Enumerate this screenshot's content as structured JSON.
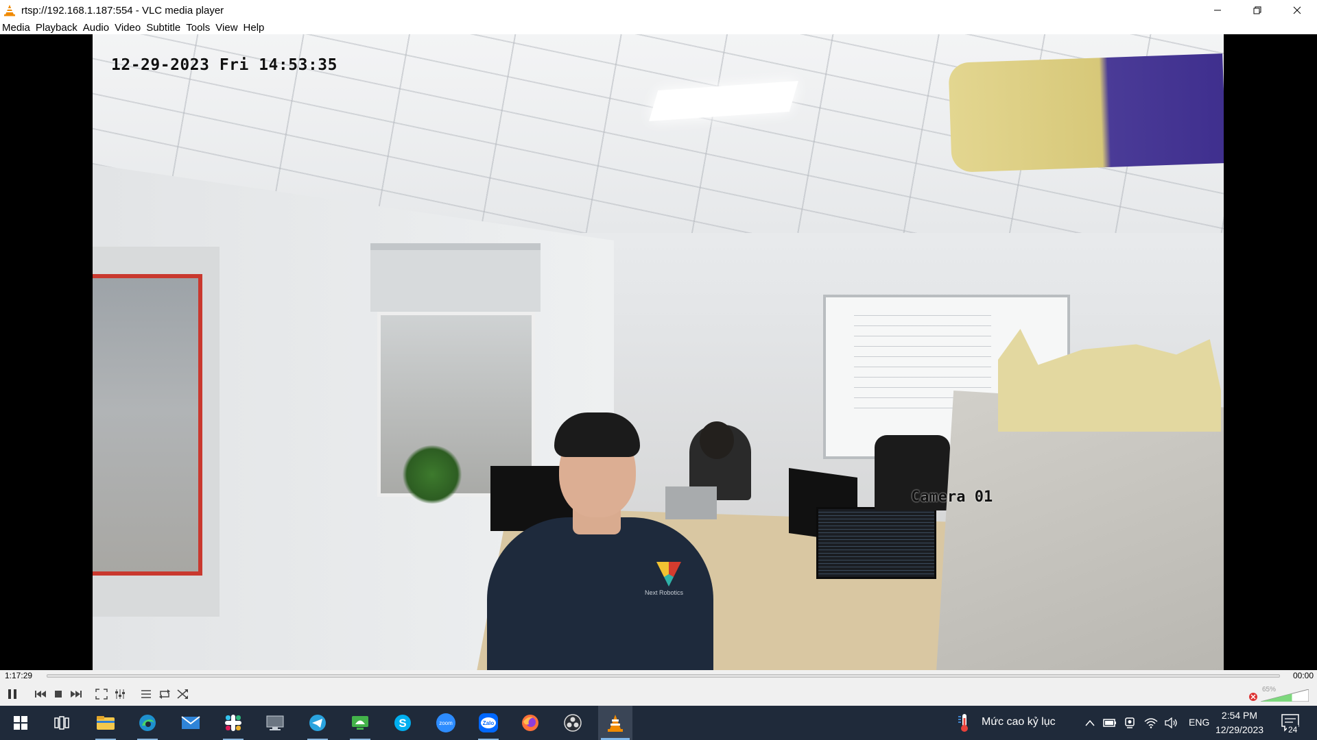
{
  "window": {
    "title": "rtsp://192.168.1.187:554 - VLC media player"
  },
  "menu": {
    "items": [
      "Media",
      "Playback",
      "Audio",
      "Video",
      "Subtitle",
      "Tools",
      "View",
      "Help"
    ]
  },
  "video": {
    "osd_datetime": "12-29-2023 Fri 14:53:35",
    "osd_camera": "Camera 01",
    "shirt_text": "Next Robotics"
  },
  "playback": {
    "elapsed": "1:17:29",
    "total": "00:00",
    "position_fraction": 0,
    "volume_label": "65%",
    "volume_fraction": 0.65,
    "controls": [
      "pause-icon",
      "previous-icon",
      "stop-icon",
      "next-icon",
      "fullscreen-icon",
      "extended-settings-icon",
      "playlist-icon",
      "loop-icon",
      "shuffle-icon"
    ],
    "volume_icon": "speaker-muted-icon"
  },
  "taskbar": {
    "apps": [
      "windows-start-icon",
      "task-view-icon",
      "file-explorer-icon",
      "edge-icon",
      "mail-icon",
      "slack-icon",
      "remote-desktop-icon",
      "telegram-icon",
      "anydesk-icon",
      "skype-icon",
      "zoom-icon",
      "zalo-icon",
      "firefox-icon",
      "obs-icon",
      "vlc-icon"
    ],
    "zoom_label": "zoom",
    "zalo_label": "Zalo",
    "weather_text": "Mức cao kỷ lục",
    "language": "ENG",
    "clock_time": "2:54 PM",
    "clock_date": "12/29/2023",
    "notification_count": "24"
  },
  "colors": {
    "vlc_orange": "#f08a00",
    "taskbar_bg": "#1f2a3a",
    "accent_blue": "#7fb6e8"
  }
}
